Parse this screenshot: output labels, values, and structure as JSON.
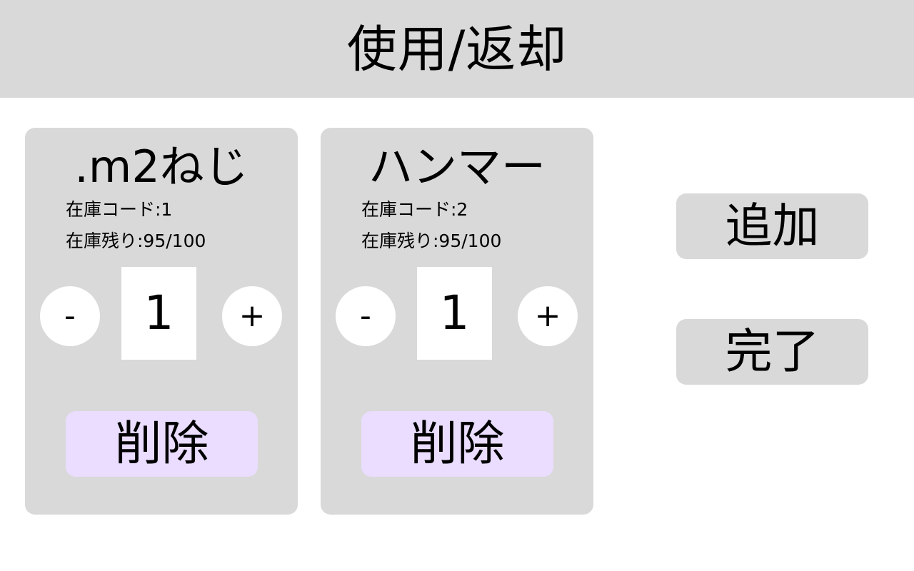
{
  "header": {
    "title": "使用/返却"
  },
  "items": [
    {
      "name": ".m2ねじ",
      "code_text": "在庫コード:1",
      "stock_text": "在庫残り:95/100",
      "quantity": "1",
      "minus_label": "-",
      "plus_label": "+",
      "delete_label": "削除"
    },
    {
      "name": "ハンマー",
      "code_text": "在庫コード:2",
      "stock_text": "在庫残り:95/100",
      "quantity": "1",
      "minus_label": "-",
      "plus_label": "+",
      "delete_label": "削除"
    }
  ],
  "actions": {
    "add_label": "追加",
    "done_label": "完了"
  },
  "colors": {
    "panel": "#d9d9d9",
    "delete_button": "#eaddff",
    "background": "#ffffff"
  }
}
